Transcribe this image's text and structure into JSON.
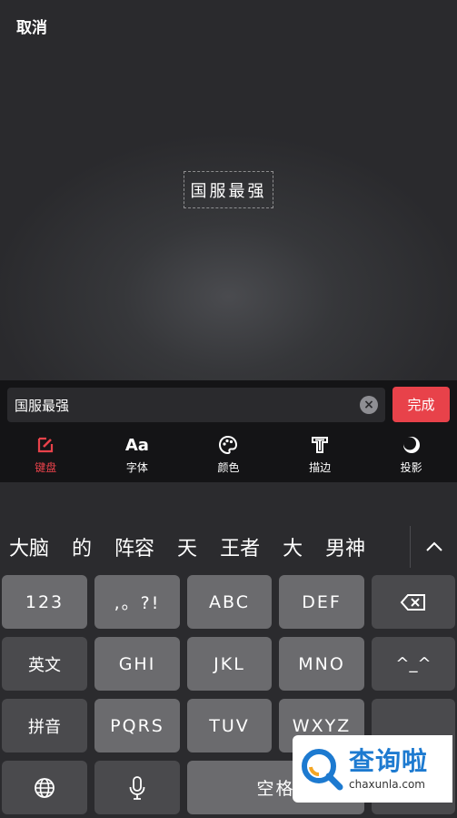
{
  "preview": {
    "cancel_label": "取消",
    "overlay_text": "国服最强"
  },
  "editor": {
    "input_value": "国服最强",
    "done_label": "完成",
    "accent_color": "#e8424a",
    "tabs": [
      {
        "label": "键盘",
        "icon": "keyboard-edit-icon",
        "active": true
      },
      {
        "label": "字体",
        "icon": "font-aa-icon",
        "glyph": "Aa"
      },
      {
        "label": "颜色",
        "icon": "palette-icon"
      },
      {
        "label": "描边",
        "icon": "stroke-t-icon"
      },
      {
        "label": "投影",
        "icon": "shadow-circle-icon"
      }
    ]
  },
  "keyboard": {
    "candidates": [
      "大脑",
      "的",
      "阵容",
      "天",
      "王者",
      "大",
      "男神"
    ],
    "row1": [
      "123",
      ",。?!",
      "ABC",
      "DEF"
    ],
    "row2": [
      "英文",
      "GHI",
      "JKL",
      "MNO",
      "^_^"
    ],
    "row3": [
      "拼音",
      "PQRS",
      "TUV",
      "WXYZ"
    ],
    "space_label": "空格"
  },
  "watermark": {
    "title": "查询啦",
    "url": "chaxunla.com"
  }
}
